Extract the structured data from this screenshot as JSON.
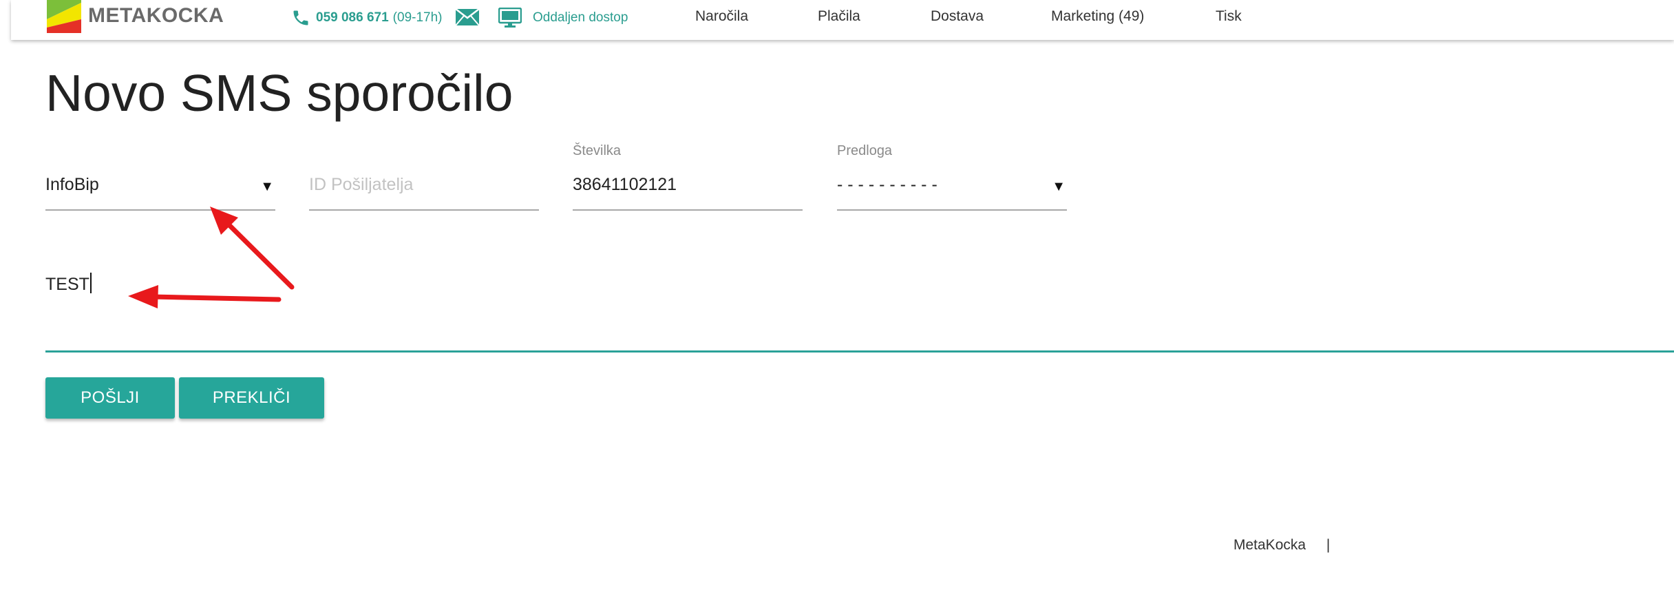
{
  "header": {
    "logo_text": "METAKOCKA",
    "phone_number": "059 086 671",
    "phone_hours": "(09-17h)",
    "remote_access_label": "Oddaljen dostop",
    "nav_items": [
      "Naročila",
      "Plačila",
      "Dostava",
      "Marketing (49)",
      "Tisk"
    ],
    "icons": [
      "phone-icon",
      "mail-icon",
      "monitor-icon"
    ],
    "accent_color": "#2a9d8f"
  },
  "page": {
    "title": "Novo SMS sporočilo"
  },
  "form": {
    "provider_value": "InfoBip",
    "sender_id_placeholder": "ID Pošiljatelja",
    "number_label": "Številka",
    "number_value": "38641102121",
    "template_label": "Predloga",
    "template_value": "- - - - - - - - - -",
    "message_value": "TEST"
  },
  "buttons": {
    "send_label": "POŠLJI",
    "cancel_label": "PREKLIČI",
    "color": "#26a69a"
  },
  "footer": {
    "brand": "MetaKocka",
    "separator": "|"
  },
  "annotations": {
    "arrow_color": "#e8191c"
  }
}
